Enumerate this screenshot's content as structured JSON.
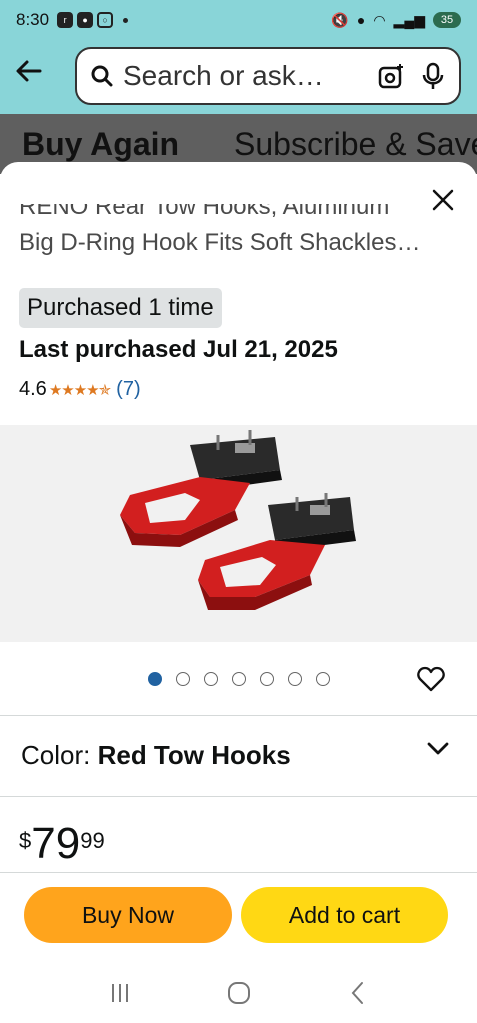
{
  "status": {
    "time": "8:30",
    "battery": "35"
  },
  "header": {
    "search_placeholder": "Search or ask…"
  },
  "bg_tabs": [
    "Buy Again",
    "Subscribe & Save"
  ],
  "product": {
    "title_line1": "RENO Rear Tow Hooks, Aluminum",
    "title_line2": "Big D-Ring Hook Fits Soft Shackles…",
    "purchased_badge": "Purchased 1 time",
    "last_purchased": "Last purchased Jul 21, 2025",
    "rating": "4.6",
    "stars": "★★★★✯",
    "review_count": "(7)",
    "image_count": 7,
    "active_image": 1,
    "color_label": "Color: ",
    "color_value": "Red Tow Hooks",
    "price_symbol": "$",
    "price_whole": "79",
    "price_fraction": "99"
  },
  "actions": {
    "buy_now": "Buy Now",
    "add_to_cart": "Add to cart"
  },
  "colors": {
    "header_bg": "#89d5d8",
    "buy_now": "#ffa41c",
    "add_to_cart": "#ffd814",
    "link": "#2162a1",
    "star": "#de7921"
  }
}
